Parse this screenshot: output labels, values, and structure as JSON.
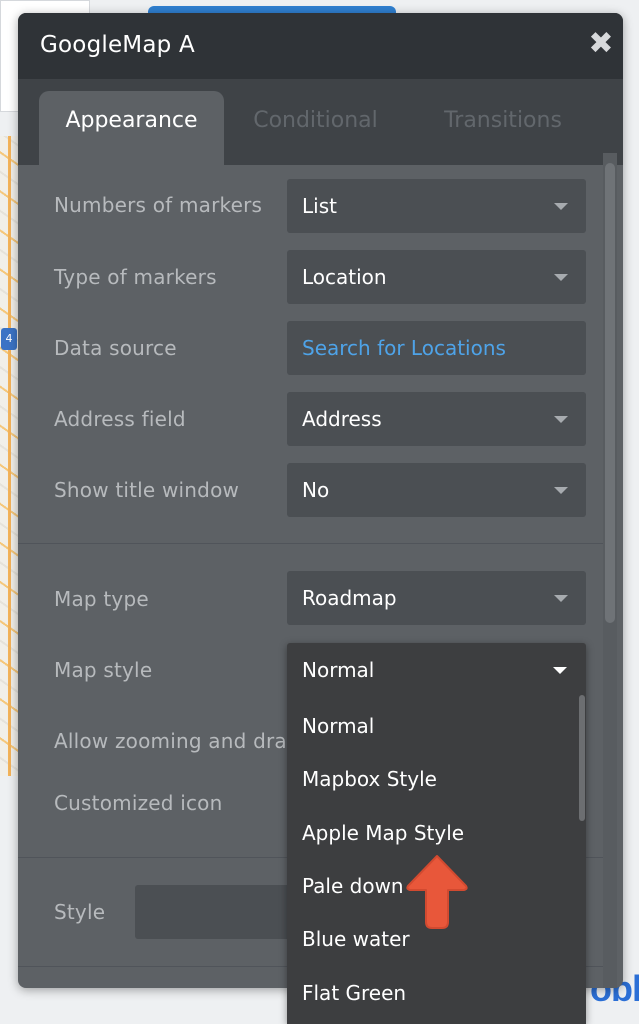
{
  "dialog": {
    "title": "GoogleMap A",
    "close_icon": "close-icon"
  },
  "tabs": [
    {
      "label": "Appearance",
      "active": true
    },
    {
      "label": "Conditional",
      "active": false
    },
    {
      "label": "Transitions",
      "active": false
    }
  ],
  "properties": {
    "markers_count": {
      "label": "Numbers of markers",
      "value": "List"
    },
    "markers_type": {
      "label": "Type of markers",
      "value": "Location"
    },
    "data_source": {
      "label": "Data source",
      "value": "Search for Locations"
    },
    "address_field": {
      "label": "Address field",
      "value": "Address"
    },
    "title_window": {
      "label": "Show title window",
      "value": "No"
    },
    "map_type": {
      "label": "Map type",
      "value": "Roadmap"
    },
    "map_style": {
      "label": "Map style",
      "value": "Normal",
      "options": [
        "Normal",
        "Mapbox Style",
        "Apple Map Style",
        "Pale down",
        "Blue water",
        "Flat Green"
      ]
    },
    "zooming": {
      "label": "Allow zooming and drag"
    },
    "custom_icon": {
      "label": "Customized icon"
    },
    "style": {
      "label": "Style"
    }
  },
  "background": {
    "map_badge": "4",
    "logo_text": "oble"
  },
  "colors": {
    "link": "#4ea3e8",
    "arrow": "#e8573a",
    "dialog_bg": "#5d6165",
    "header_bg": "#2f3337"
  }
}
